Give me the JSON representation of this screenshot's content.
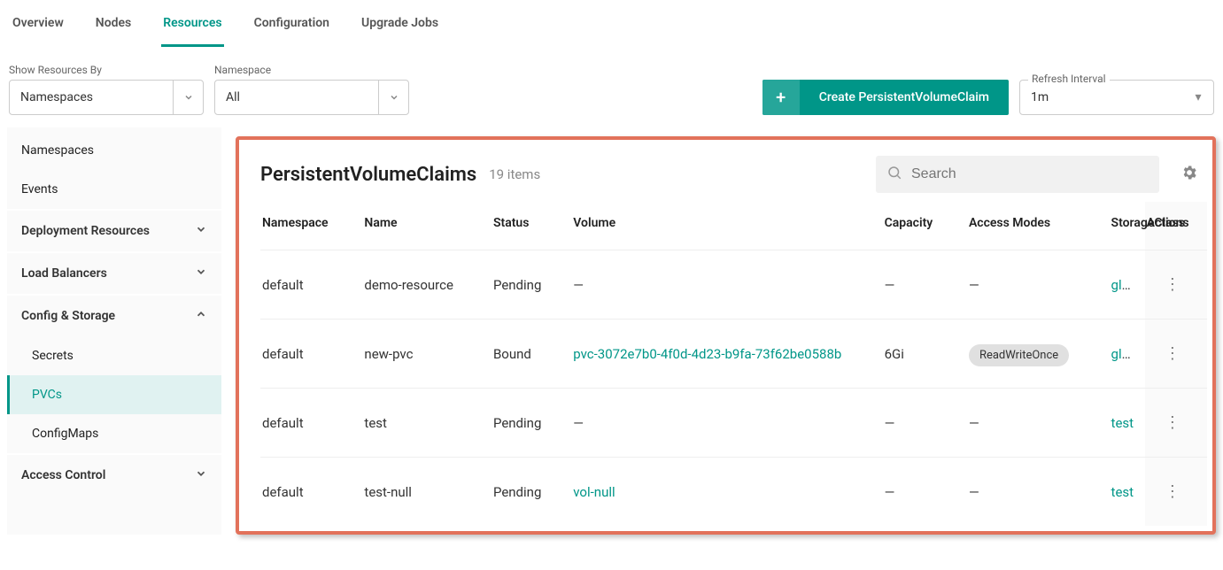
{
  "tabs": [
    "Overview",
    "Nodes",
    "Resources",
    "Configuration",
    "Upgrade Jobs"
  ],
  "active_tab": "Resources",
  "filters": {
    "show_by_label": "Show Resources By",
    "show_by_value": "Namespaces",
    "namespace_label": "Namespace",
    "namespace_value": "All"
  },
  "create_button": "Create PersistentVolumeClaim",
  "refresh": {
    "label": "Refresh Interval",
    "value": "1m"
  },
  "sidebar": {
    "top": [
      "Namespaces",
      "Events"
    ],
    "groups": [
      {
        "label": "Deployment Resources",
        "open": false
      },
      {
        "label": "Load Balancers",
        "open": false
      },
      {
        "label": "Config & Storage",
        "open": true,
        "items": [
          "Secrets",
          "PVCs",
          "ConfigMaps"
        ],
        "active": "PVCs"
      },
      {
        "label": "Access Control",
        "open": false
      }
    ]
  },
  "panel": {
    "title": "PersistentVolumeClaims",
    "count_text": "19 items",
    "search_placeholder": "Search"
  },
  "columns": [
    "Namespace",
    "Name",
    "Status",
    "Volume",
    "Capacity",
    "Access Modes",
    "StorageClass",
    "Actions"
  ],
  "rows": [
    {
      "ns": "default",
      "name": "demo-resource",
      "status": "Pending",
      "volume": "—",
      "volume_link": false,
      "capacity": "—",
      "access": "—",
      "access_chip": false,
      "sc": "gluster",
      "sc_link": true
    },
    {
      "ns": "default",
      "name": "new-pvc",
      "status": "Bound",
      "volume": "pvc-3072e7b0-4f0d-4d23-b9fa-73f62be0588b",
      "volume_link": true,
      "capacity": "6Gi",
      "access": "ReadWriteOnce",
      "access_chip": true,
      "sc": "gluster",
      "sc_link": true
    },
    {
      "ns": "default",
      "name": "test",
      "status": "Pending",
      "volume": "—",
      "volume_link": false,
      "capacity": "—",
      "access": "—",
      "access_chip": false,
      "sc": "test",
      "sc_link": true
    },
    {
      "ns": "default",
      "name": "test-null",
      "status": "Pending",
      "volume": "vol-null",
      "volume_link": true,
      "capacity": "—",
      "access": "—",
      "access_chip": false,
      "sc": "test",
      "sc_link": true
    }
  ]
}
